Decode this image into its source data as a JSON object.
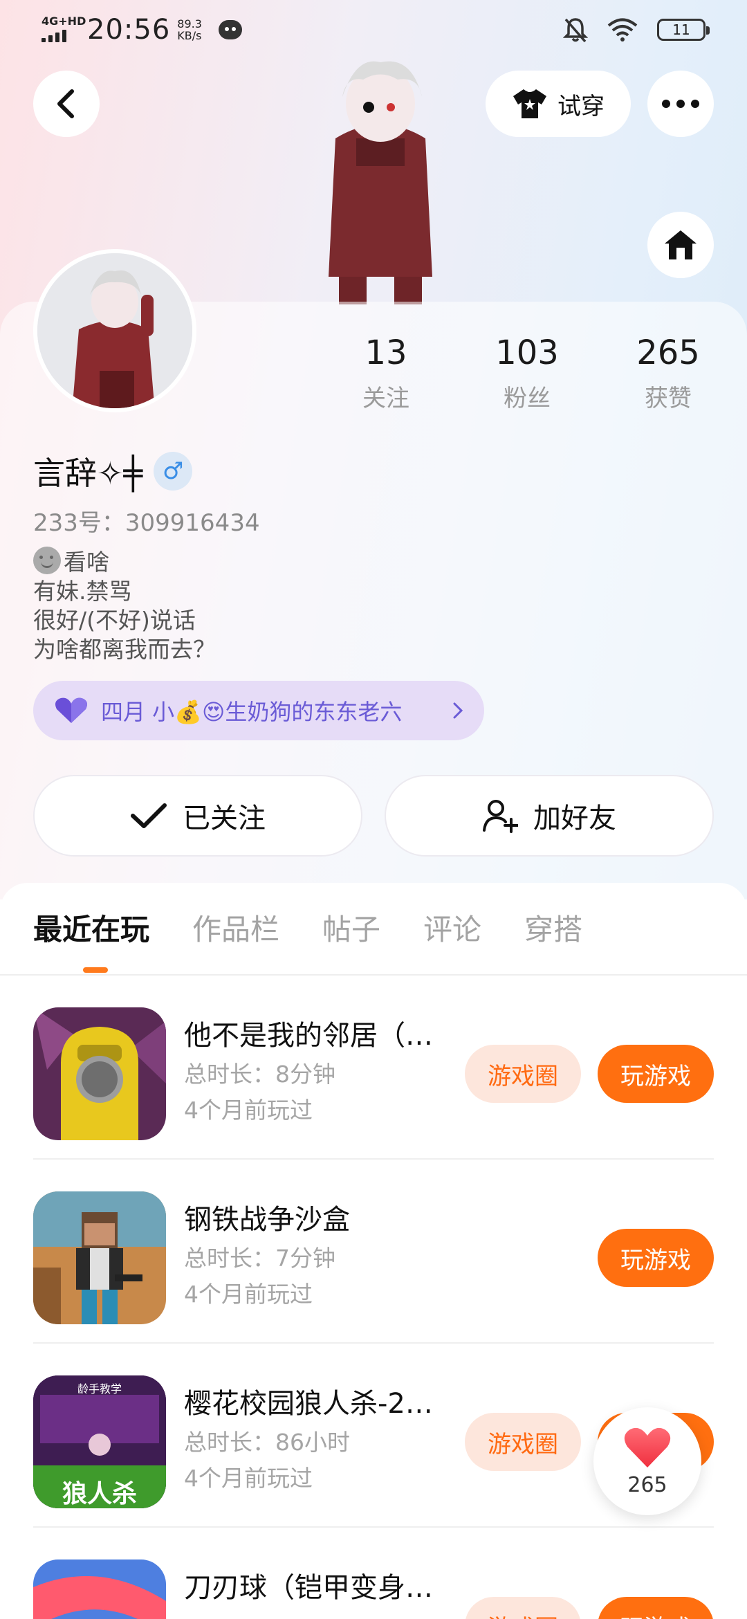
{
  "status_bar": {
    "network": "4G+HD",
    "time": "20:56",
    "speed_value": "89.3",
    "speed_unit": "KB/s",
    "battery": "11"
  },
  "header": {
    "try_on_label": "试穿",
    "icons": [
      "back-icon",
      "tshirt-icon",
      "more-icon",
      "home-icon"
    ]
  },
  "profile": {
    "stats": [
      {
        "num": "13",
        "label": "关注"
      },
      {
        "num": "103",
        "label": "粉丝"
      },
      {
        "num": "265",
        "label": "获赞"
      }
    ],
    "username": "言辞✧╪",
    "gender_symbol": "♂",
    "uid": "233号：309916434",
    "bio": [
      "看啥",
      "有妹.禁骂",
      "很好/(不好)说话",
      "为啥都离我而去？"
    ],
    "guild": "四月 小💰😍生奶狗的东东老六",
    "follow_label": "已关注",
    "add_friend_label": "加好友"
  },
  "tabs": [
    "最近在玩",
    "作品栏",
    "帖子",
    "评论",
    "穿搭"
  ],
  "games": [
    {
      "title": "他不是我的邻居（…",
      "duration": "总时长：8分钟",
      "last_played": "4个月前玩过",
      "circle_label": "游戏圈",
      "play_label": "玩游戏"
    },
    {
      "title": "钢铁战争沙盒",
      "duration": "总时长：7分钟",
      "last_played": "4个月前玩过",
      "play_label": "玩游戏"
    },
    {
      "title": "樱花校园狼人杀-2…",
      "duration": "总时长：86小时",
      "last_played": "4个月前玩过",
      "circle_label": "游戏圈",
      "play_label": "玩游戏",
      "icon_text_top": "龄手教学",
      "icon_text_bottom": "狼人杀"
    },
    {
      "title": "刀刃球（铠甲变身…",
      "circle_label": "游戏圈",
      "play_label": "玩游戏"
    }
  ],
  "like_float": {
    "count": "265"
  },
  "colors": {
    "accent": "#ff6f10",
    "guild_text": "#6a5bd6",
    "gender": "#3a8ee6"
  }
}
